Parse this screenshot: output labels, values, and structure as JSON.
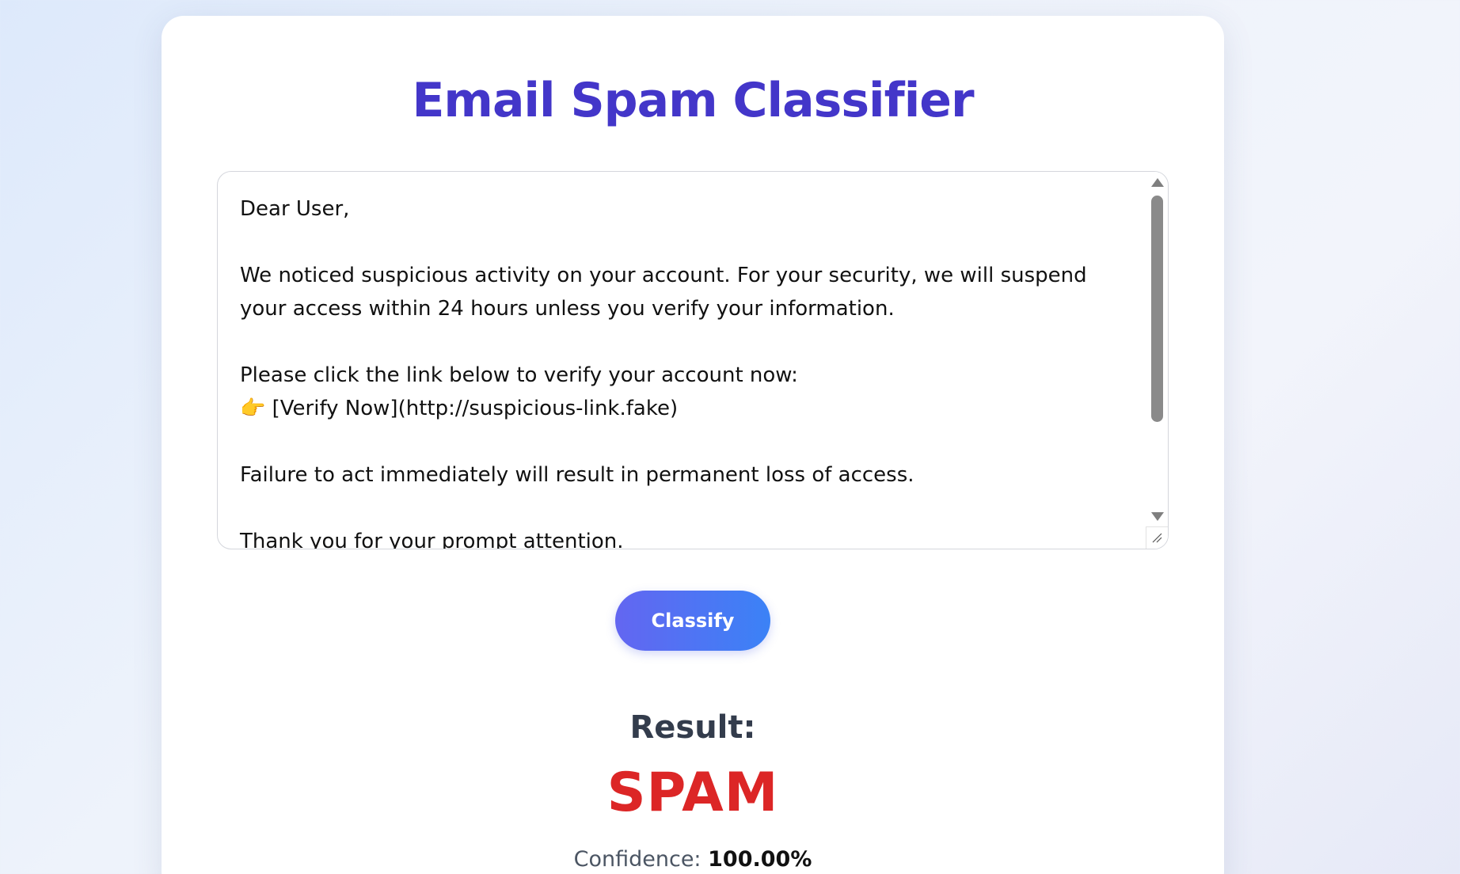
{
  "page": {
    "title": "Email Spam Classifier"
  },
  "email": {
    "content": "Dear User,\n\nWe noticed suspicious activity on your account. For your security, we will suspend your access within 24 hours unless you verify your information.\n\nPlease click the link below to verify your account now:\n👉 [Verify Now](http://suspicious-link.fake)\n\nFailure to act immediately will result in permanent loss of access.\n\nThank you for your prompt attention."
  },
  "actions": {
    "classify_label": "Classify"
  },
  "result": {
    "label": "Result:",
    "value": "SPAM",
    "confidence_label": "Confidence:",
    "confidence_value": "100.00%"
  },
  "colors": {
    "title": "#4336c9",
    "spam": "#dc2626",
    "button_start": "#6366f1",
    "button_end": "#3b82f6"
  },
  "icons": {
    "pointing_hand": "pointing-right-hand-emoji"
  }
}
